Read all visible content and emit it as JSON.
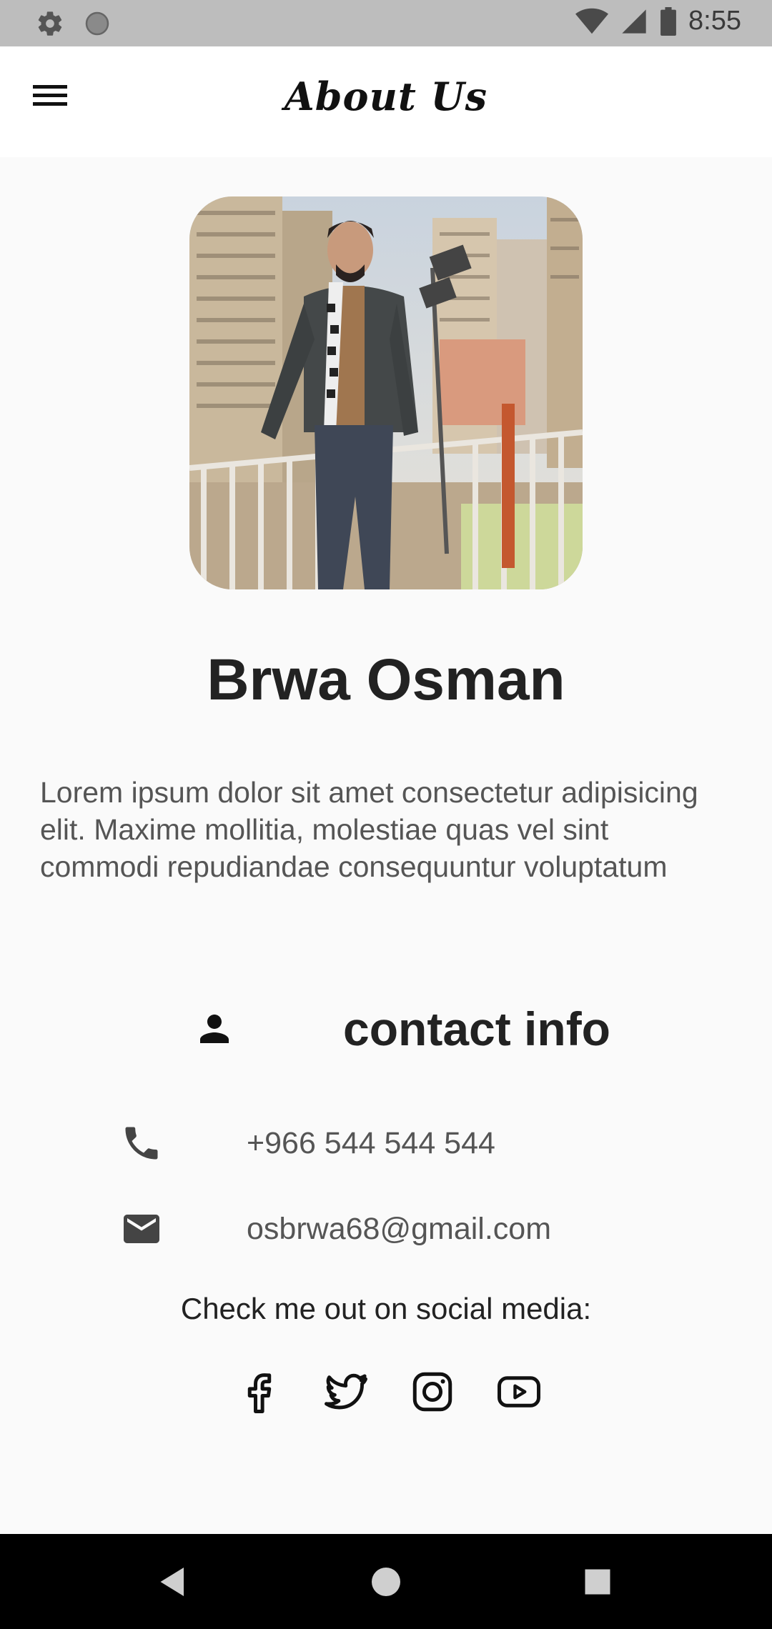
{
  "status_bar": {
    "time": "8:55"
  },
  "app_bar": {
    "title": "About Us"
  },
  "profile": {
    "name": "Brwa Osman",
    "bio": "Lorem ipsum dolor sit amet consectetur adipisicing elit. Maxime mollitia, molestiae quas vel sint commodi repudiandae consequuntur voluptatum"
  },
  "contact": {
    "title": "contact info",
    "phone": "+966 544 544 544",
    "email": "osbrwa68@gmail.com"
  },
  "social": {
    "caption": "Check me out on social media:",
    "icons": [
      "facebook-icon",
      "twitter-icon",
      "instagram-icon",
      "youtube-icon"
    ]
  },
  "colors": {
    "status_bar": "#bdbdbd",
    "background": "#fafafa",
    "text_dark": "#222222",
    "text_muted": "#555555"
  }
}
